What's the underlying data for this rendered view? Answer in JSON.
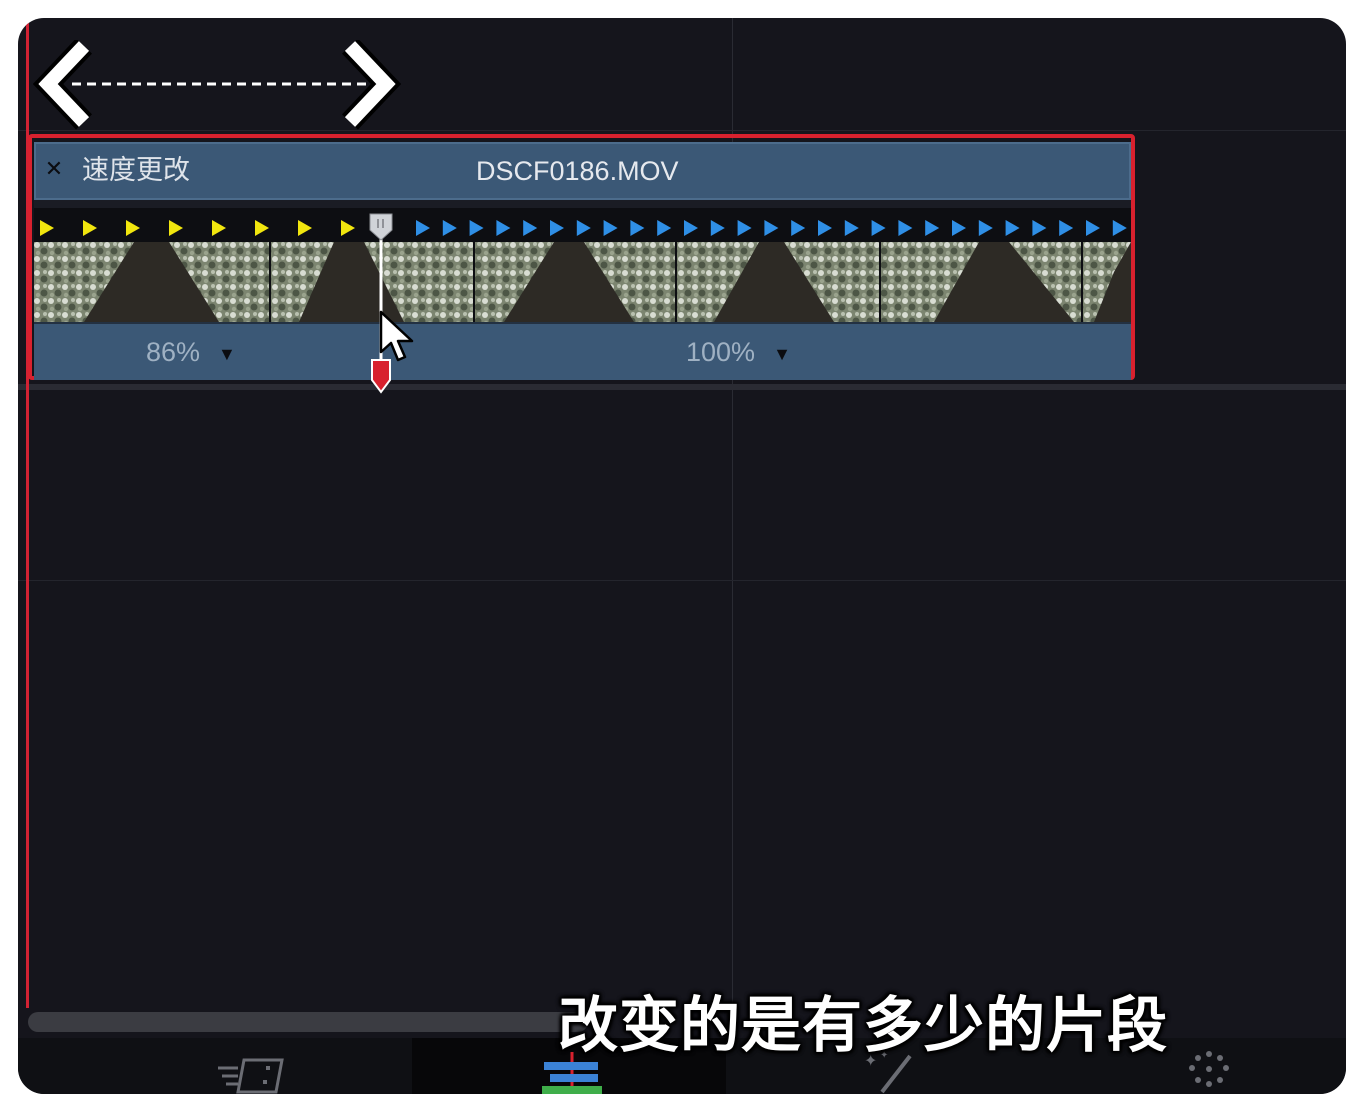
{
  "clip": {
    "effect_label": "速度更改",
    "filename": "DSCF0186.MOV",
    "segments": [
      {
        "speed": "86%",
        "marker_color": "#f1e60e"
      },
      {
        "speed": "100%",
        "marker_color": "#2f8fe6"
      }
    ]
  },
  "subtitle": "改变的是有多少的片段",
  "colors": {
    "selection_outline": "#d8212e",
    "clip_header": "#3b5876",
    "playhead": "#d22233",
    "background": "#15151c"
  },
  "icons": [
    "close-icon",
    "retime-handle-icon",
    "mouse-cursor-icon",
    "drag-arrows-icon",
    "speed-tab-icon",
    "edit-tab-icon",
    "effects-tab-icon",
    "color-tab-icon"
  ]
}
